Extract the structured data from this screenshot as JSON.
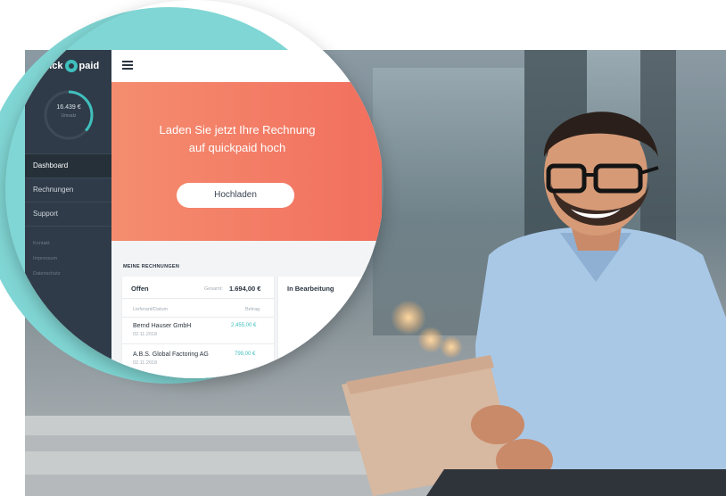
{
  "app": {
    "logo": {
      "left": "quick",
      "right": "paid"
    },
    "balance": {
      "value": "16.439 €",
      "caption": "Umsatz"
    },
    "nav": {
      "items": [
        {
          "label": "Dashboard",
          "active": true
        },
        {
          "label": "Rechnungen",
          "active": false
        },
        {
          "label": "Support",
          "active": false
        }
      ],
      "links": [
        "Kontakt",
        "Impressum",
        "Datenschutz"
      ]
    },
    "hero": {
      "line1": "Laden Sie jetzt Ihre Rechnung",
      "line2": "auf quickpaid hoch",
      "button": "Hochladen"
    },
    "invoices": {
      "section_title": "MEINE RECHNUNGEN",
      "open": {
        "title": "Offen",
        "total_label": "Gesamt:",
        "total_value": "1.694,00 €",
        "col_left": "Lieferant/Datum",
        "col_right": "Betrag",
        "rows": [
          {
            "supplier": "Bernd Hauser GmbH",
            "date": "02.11.2018",
            "amount": "2.455,00 €"
          },
          {
            "supplier": "A.B.S. Global Factoring AG",
            "date": "02.11.2018",
            "amount": "799,00 €"
          }
        ]
      },
      "processing": {
        "title": "In Bearbeitung"
      }
    }
  },
  "colors": {
    "sidebar": "#2f3b48",
    "accent": "#3fbfbd",
    "hero_start": "#f48d6f",
    "hero_end": "#f26f5e",
    "circle_bg": "#80d6d4"
  }
}
